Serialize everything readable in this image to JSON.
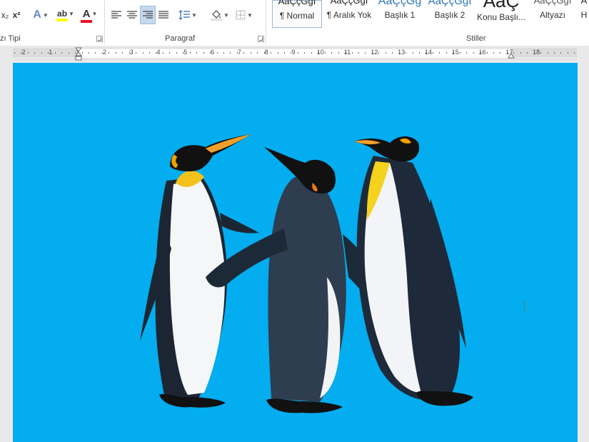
{
  "ribbon": {
    "font_group_label": "zı Tipi",
    "paragraph_group_label": "Paragraf",
    "styles_group_label": "Stiller",
    "font_buttons": {
      "subscript": "x₂",
      "superscript": "x²",
      "text_effects": "A",
      "highlight": "ab",
      "font_color": "A"
    },
    "styles": [
      {
        "preview": "AaÇçĞğİ",
        "name": "¶ Normal",
        "selected": true
      },
      {
        "preview": "AaÇçĞğİ",
        "name": "¶ Aralık Yok",
        "selected": false
      },
      {
        "preview": "AaÇçĞğ",
        "name": "Başlık 1",
        "selected": false
      },
      {
        "preview": "AaÇçĞğİ",
        "name": "Başlık 2",
        "selected": false
      },
      {
        "preview": "AaÇ",
        "name": "Konu Başlı...",
        "selected": false
      },
      {
        "preview": "AaÇçĞğİ",
        "name": "Altyazı",
        "selected": false
      },
      {
        "preview": "A",
        "name": "H",
        "selected": false
      }
    ]
  },
  "ruler": {
    "labels": [
      "2",
      "1",
      "1",
      "2",
      "3",
      "4",
      "5",
      "6",
      "7",
      "8",
      "9",
      "10",
      "11",
      "12",
      "13",
      "14",
      "15",
      "16",
      "17",
      "18"
    ]
  },
  "colors": {
    "image_background": "#03adef",
    "highlight_bar": "#ffff00",
    "font_color_bar": "#e81123",
    "selected_button": "#c5d9ee"
  }
}
